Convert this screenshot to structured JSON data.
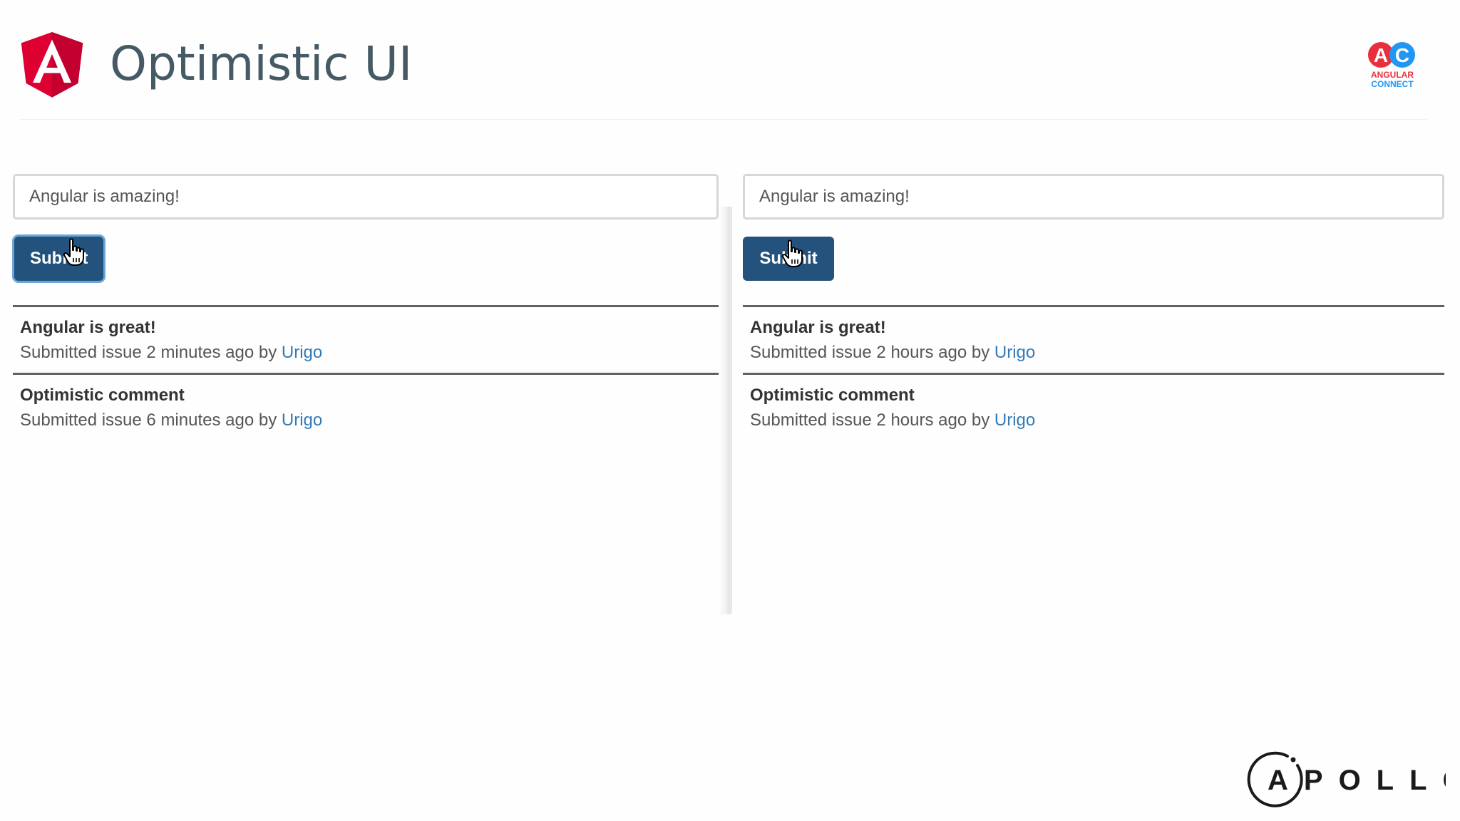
{
  "slide": {
    "title": "Optimistic UI",
    "conference_logo_text": [
      "ANGULAR",
      "CONNECT"
    ],
    "sponsor_logo_text": "APOLLO"
  },
  "panels": [
    {
      "input": {
        "value": "Angular is amazing!"
      },
      "submit_label": "Submit",
      "issues": [
        {
          "title": "Angular is great!",
          "meta_prefix": "Submitted issue 2 minutes ago by",
          "author": "Urigo"
        },
        {
          "title": "Optimistic comment",
          "meta_prefix": "Submitted issue 6 minutes ago by",
          "author": "Urigo"
        }
      ]
    },
    {
      "input": {
        "value": "Angular is amazing!"
      },
      "submit_label": "Submit",
      "issues": [
        {
          "title": "Angular is great!",
          "meta_prefix": "Submitted issue 2 hours ago by",
          "author": "Urigo"
        },
        {
          "title": "Optimistic comment",
          "meta_prefix": "Submitted issue 2 hours ago by",
          "author": "Urigo"
        }
      ]
    }
  ],
  "colors": {
    "button": "#23527c",
    "link": "#337ab7",
    "angular_red": "#dd0031",
    "title_gray": "#455a64"
  },
  "icons": [
    "angular-logo-icon",
    "angular-connect-logo-icon",
    "hand-pointer-icon",
    "apollo-logo-icon"
  ]
}
